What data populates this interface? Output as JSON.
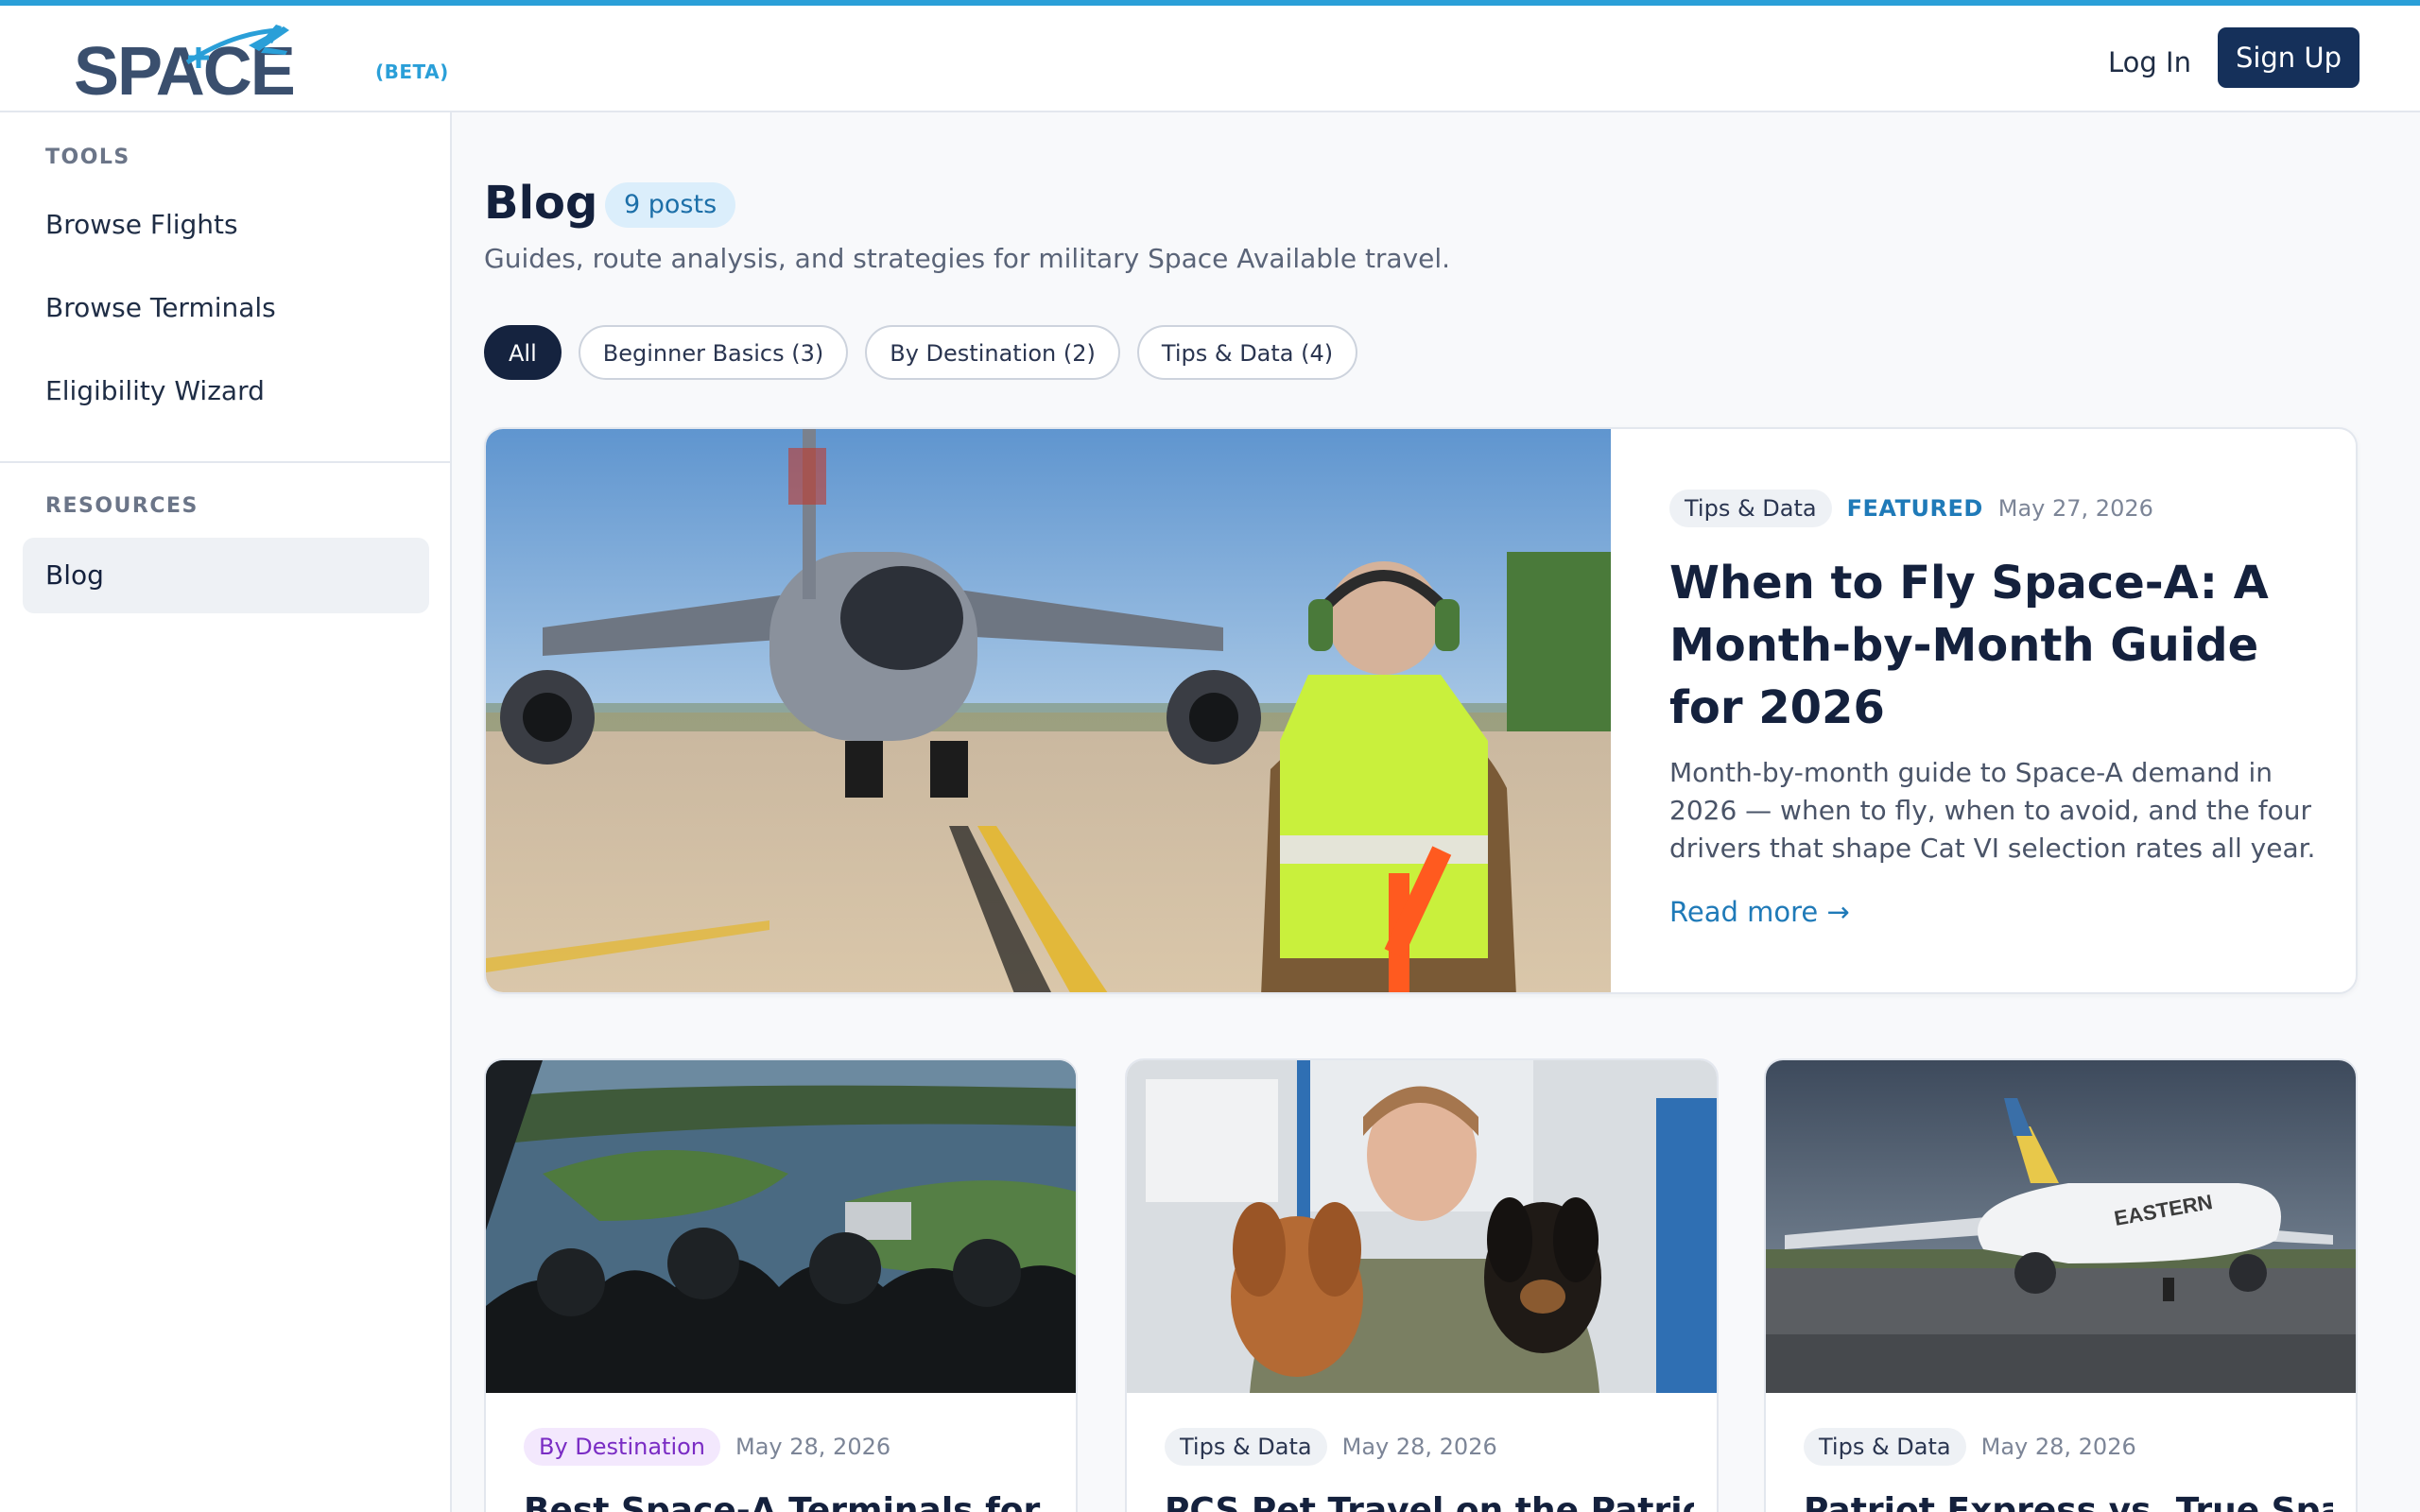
{
  "header": {
    "logo_text": "SPACE",
    "beta_label": "(BETA)",
    "login_label": "Log In",
    "signup_label": "Sign Up"
  },
  "sidebar": {
    "sections": [
      {
        "heading": "TOOLS",
        "items": [
          {
            "label": "Browse Flights"
          },
          {
            "label": "Browse Terminals"
          },
          {
            "label": "Eligibility Wizard"
          }
        ]
      },
      {
        "heading": "RESOURCES",
        "items": [
          {
            "label": "Blog",
            "active": true
          }
        ]
      }
    ]
  },
  "main": {
    "title": "Blog",
    "post_count": "9 posts",
    "subtitle": "Guides, route analysis, and strategies for military Space Available travel.",
    "filters": [
      {
        "label": "All",
        "active": true
      },
      {
        "label": "Beginner Basics (3)"
      },
      {
        "label": "By Destination (2)"
      },
      {
        "label": "Tips & Data (4)"
      }
    ],
    "featured": {
      "tag": "Tips & Data",
      "label": "FEATURED",
      "date": "May 27, 2026",
      "title": "When to Fly Space-A: A Month-by-Month Guide for 2026",
      "excerpt": "Month-by-month guide to Space-A demand in 2026 — when to fly, when to avoid, and the four drivers that shape Cat VI selection rates all year.",
      "read_more": "Read more →",
      "image": "tanker-aircraft-ground-crew-photo"
    },
    "cards": [
      {
        "tag": "By Destination",
        "date": "May 28, 2026",
        "title": "Best Space-A Terminals for",
        "image": "cargo-ramp-aerial-view-photo"
      },
      {
        "tag": "Tips & Data",
        "date": "May 28, 2026",
        "title": "PCS Pet Travel on the Patriot",
        "image": "soldier-with-dogs-photo"
      },
      {
        "tag": "Tips & Data",
        "date": "May 28, 2026",
        "title": "Patriot Express vs. True Space-",
        "image": "eastern-airliner-photo"
      }
    ]
  },
  "colors": {
    "accent": "#2a9fd8",
    "brand_navy": "#15305a",
    "link": "#1f7ab8",
    "purple_tag": "#7a2cc4"
  }
}
